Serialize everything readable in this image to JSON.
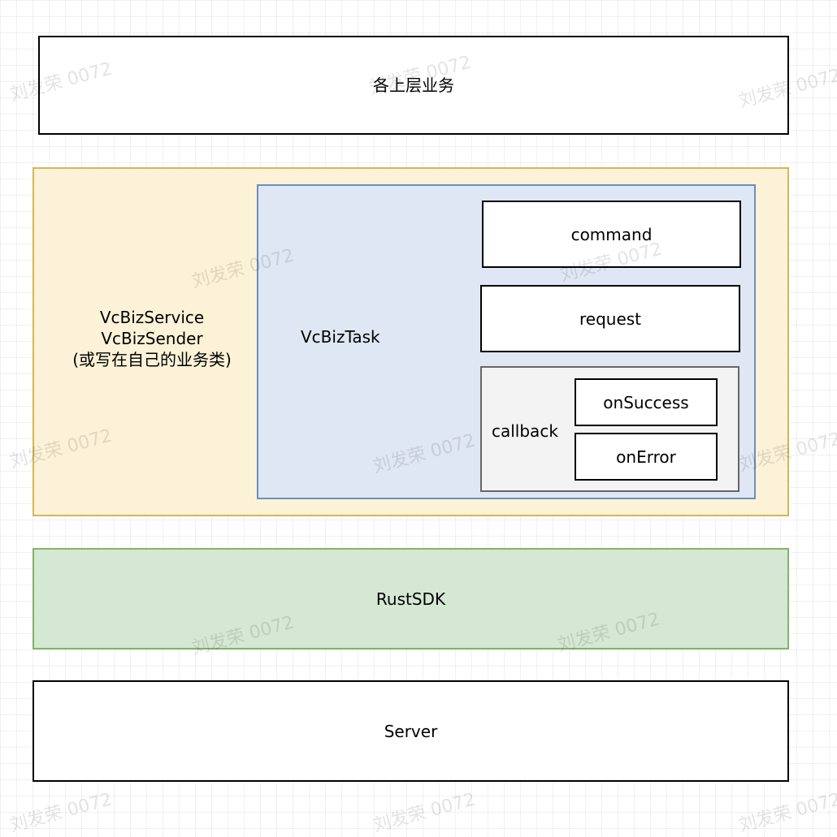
{
  "layers": {
    "top": "各上层业务",
    "service": {
      "lines": [
        "VcBizService",
        "VcBizSender",
        "(或写在自己的业务类)"
      ],
      "task": {
        "label": "VcBizTask",
        "command": "command",
        "request": "request",
        "callback": {
          "label": "callback",
          "on_success": "onSuccess",
          "on_error": "onError"
        }
      }
    },
    "sdk": "RustSDK",
    "server": "Server"
  },
  "watermark_text": "刘发荣 0072",
  "colors": {
    "service_fill": "#fbf2d7",
    "service_border": "#d6b656",
    "task_fill": "#dfe7f4",
    "task_border": "#6c8ebf",
    "callback_fill": "#f3f3f3",
    "sdk_fill": "#d5e8d4",
    "sdk_border": "#82b366"
  }
}
